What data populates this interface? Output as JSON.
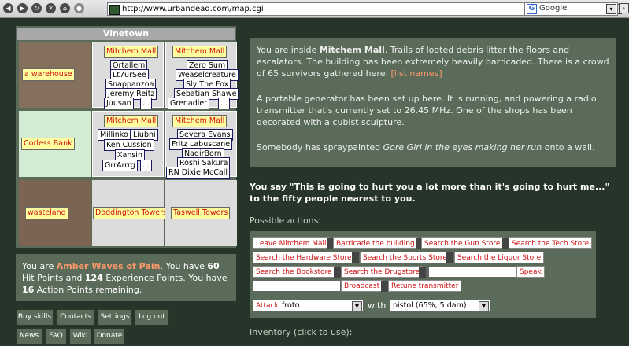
{
  "browser": {
    "url": "http://www.urbandead.com/map.cgi",
    "search_placeholder": "Google",
    "help_label": "?",
    "nav_icons": [
      "back-icon",
      "forward-icon",
      "reload-icon",
      "stop-icon",
      "home-icon",
      "history-icon"
    ]
  },
  "map": {
    "title": "Vinetown",
    "cells": [
      {
        "label": "a warehouse",
        "color": "#84705c",
        "survivors": []
      },
      {
        "label": "Mitchem Mall",
        "color": "#dcdcdc",
        "survivors": [
          "Ortallem",
          "Lt7urSee",
          "Snappanzoa",
          "Jeremy Reitz",
          "Juusan"
        ],
        "more": "..."
      },
      {
        "label": "Mitchem Mall",
        "color": "#dcdcdc",
        "survivors": [
          "Zero Sum",
          "Weaselcreature",
          "Sly The Fox",
          "Sebatian Shawe",
          "Grenadier"
        ],
        "more": "..."
      },
      {
        "label": "Corless Bank",
        "color": "#d4ecd4",
        "survivors": []
      },
      {
        "label": "Mitchem Mall",
        "color": "#dcdcdc",
        "survivors": [
          "Millinko",
          "Liubni",
          "Ken Cussion",
          "Xansin",
          "GrrArrrg"
        ],
        "more": "..."
      },
      {
        "label": "Mitchem Mall",
        "color": "#dcdcdc",
        "survivors": [
          "Severa Evans",
          "Fritz Labuscane",
          "NadirBorn",
          "Roshi Sakura",
          "RN Dixie McCall"
        ],
        "more": "..."
      },
      {
        "label": "wasteland",
        "color": "#7b6552",
        "survivors": []
      },
      {
        "label": "Doddington Towers",
        "color": "#dcdcdc",
        "survivors": []
      },
      {
        "label": "Taswell Towers",
        "color": "#dcdcdc",
        "survivors": []
      }
    ]
  },
  "status": {
    "you_are": "You are ",
    "name": "Amber Waves of Pain",
    "you_have": ". You have ",
    "hp": "60",
    "hp_text": " Hit Points and ",
    "xp": "124",
    "xp_text": " Experience Points. You have ",
    "ap": "16",
    "ap_text": " Action Points remaining."
  },
  "links": [
    "Buy skills",
    "Contacts",
    "Settings",
    "Log out",
    "News",
    "FAQ",
    "Wiki",
    "Donate"
  ],
  "description": {
    "p1_a": "You are inside ",
    "p1_place": "Mitchem Mall",
    "p1_b": ". Trails of looted debris litter the floors and escalators. The building has been extremely heavily barricaded. There is a crowd of 65 survivors gathered here. ",
    "list_names": "[list names]",
    "p2": "A portable generator has been set up here. It is running, and powering a radio transmitter that's currently set to 26.45 MHz. One of the shops has been decorated with a cubist sculpture.",
    "p3_a": "Somebody has spraypainted ",
    "p3_spray": "Gore Girl in the eyes making her run",
    "p3_b": " onto a wall."
  },
  "say_text": "You say \"This is going to hurt you a lot more than it's going to hurt me...\" to the fifty people nearest to you.",
  "possible_actions_label": "Possible actions:",
  "actions": {
    "leave": "Leave Mitchem Mall",
    "barricade": "Barricade the building",
    "gun": "Search the Gun Store",
    "tech": "Search the Tech Store",
    "hardware": "Search the Hardware Store",
    "sports": "Search the Sports Store",
    "liquor": "Search the Liquor Store",
    "bookstore": "Search the Bookstore",
    "drugstore": "Search the Drugstore",
    "speak": "Speak",
    "broadcast": "Broadcast",
    "retune": "Retune transmitter",
    "attack": "Attack",
    "target": "froto",
    "with": "with",
    "weapon": "pistol (65%, 5 dam)"
  },
  "inventory_label": "Inventory (click to use):"
}
